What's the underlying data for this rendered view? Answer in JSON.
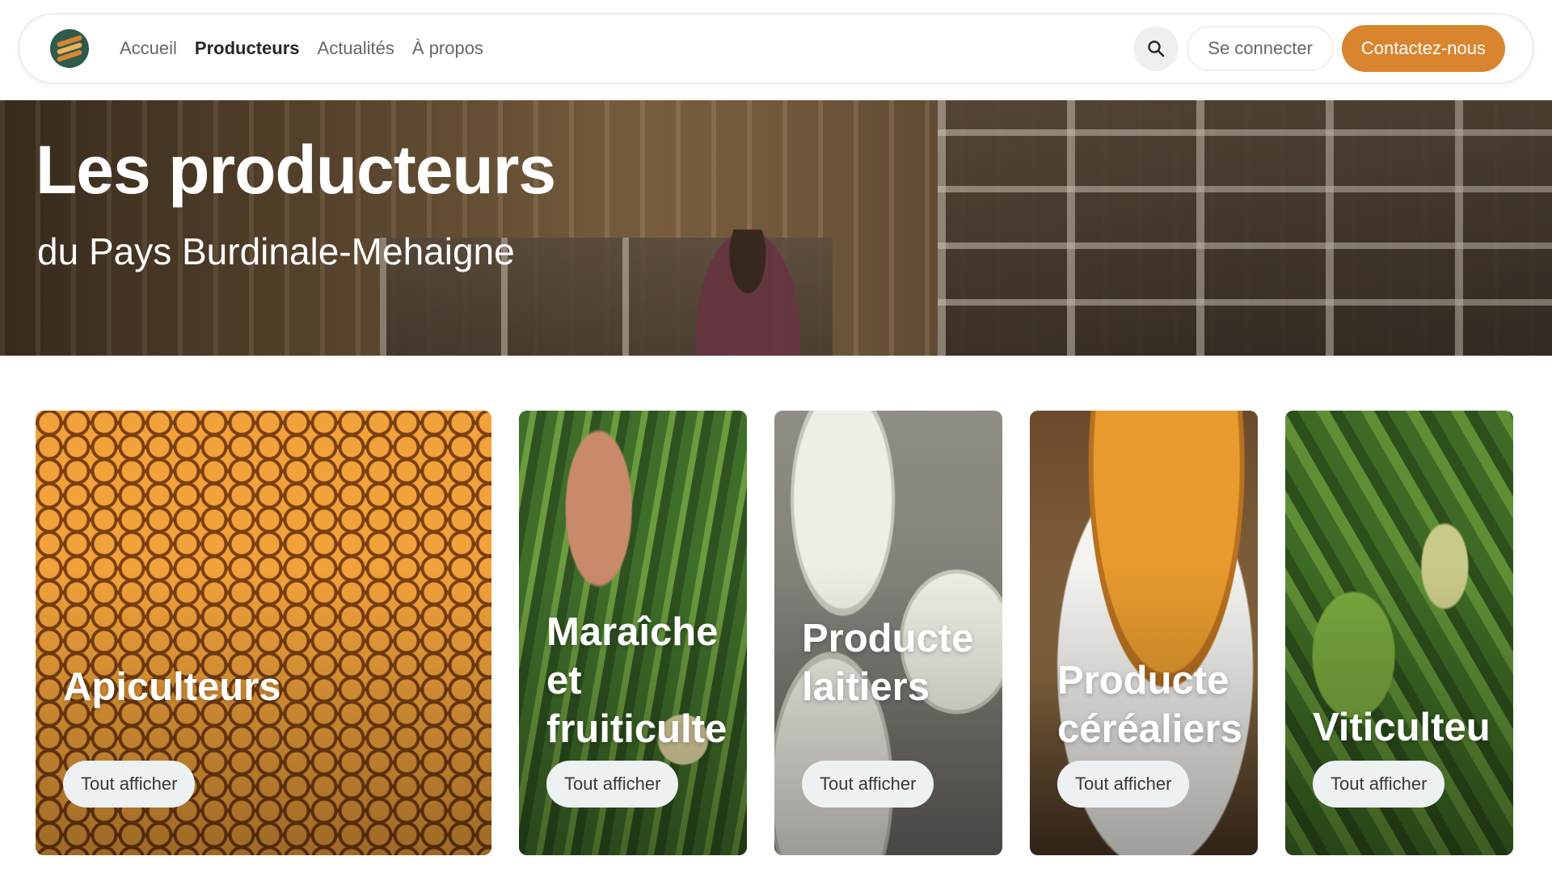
{
  "nav": {
    "logo_name": "logo",
    "links": [
      "Accueil",
      "Producteurs",
      "Actualités",
      "À propos"
    ],
    "active_link": "Producteurs",
    "search_icon": "search-icon",
    "login_label": "Se connecter",
    "contact_label": "Contactez-nous"
  },
  "hero": {
    "title": "Les producteurs",
    "subtitle": "du Pays Burdinale-Mehaigne"
  },
  "categories": [
    {
      "title": "Apiculteurs",
      "button": "Tout afficher"
    },
    {
      "title": "Maraîche\net\nfruiticulte",
      "button": "Tout afficher"
    },
    {
      "title": "Producte\nlaitiers",
      "button": "Tout afficher"
    },
    {
      "title": "Producte\ncéréaliers",
      "button": "Tout afficher"
    },
    {
      "title": "Viticulteu",
      "button": "Tout afficher"
    }
  ],
  "colors": {
    "accent": "#d9852f",
    "button_light": "#eef1f2",
    "text_dark": "#2b2622",
    "text_muted": "#6b6560"
  }
}
